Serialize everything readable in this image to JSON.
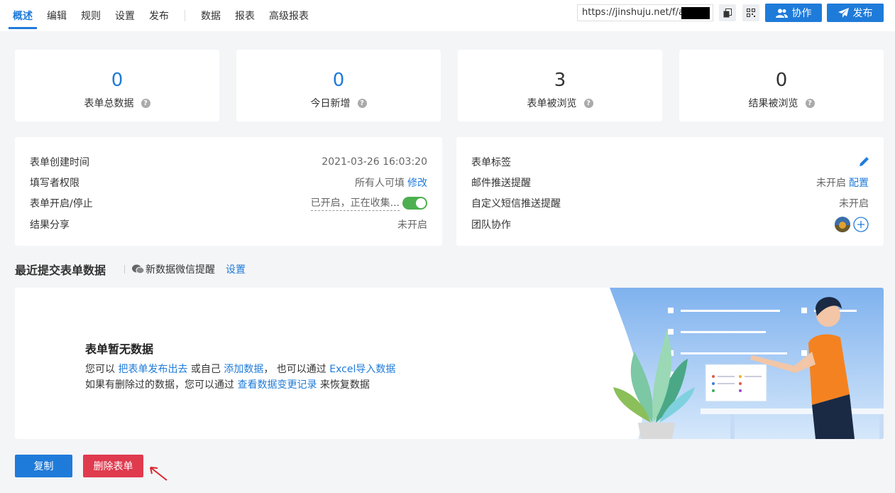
{
  "nav": {
    "tabs": [
      "概述",
      "编辑",
      "规则",
      "设置",
      "发布"
    ],
    "tabs2": [
      "数据",
      "报表",
      "高级报表"
    ],
    "url": "https://jinshuju.net/f/a",
    "collab_label": "协作",
    "publish_label": "发布"
  },
  "stats": [
    {
      "value": "0",
      "label": "表单总数据"
    },
    {
      "value": "0",
      "label": "今日新增"
    },
    {
      "value": "3",
      "label": "表单被浏览"
    },
    {
      "value": "0",
      "label": "结果被浏览"
    }
  ],
  "left_panel": {
    "created_label": "表单创建时间",
    "created_value": "2021-03-26 16:03:20",
    "perm_label": "填写者权限",
    "perm_value": "所有人可填",
    "perm_link": "修改",
    "switch_label": "表单开启/停止",
    "switch_value": "已开启，正在收集...",
    "share_label": "结果分享",
    "share_value": "未开启"
  },
  "right_panel": {
    "tag_label": "表单标签",
    "email_label": "邮件推送提醒",
    "email_value": "未开启",
    "email_link": "配置",
    "sms_label": "自定义短信推送提醒",
    "sms_value": "未开启",
    "team_label": "团队协作"
  },
  "recent": {
    "title": "最近提交表单数据",
    "wechat_label": "新数据微信提醒",
    "settings_link": "设置"
  },
  "empty": {
    "title": "表单暂无数据",
    "line1_a": "您可以 ",
    "line1_link1": "把表单发布出去",
    "line1_b": " 或自己 ",
    "line1_link2": "添加数据",
    "line1_c": "， 也可以通过 ",
    "line1_link3": "Excel导入数据",
    "line2_a": "如果有删除过的数据，您可以通过 ",
    "line2_link": "查看数据变更记录",
    "line2_b": " 来恢复数据"
  },
  "actions": {
    "copy_label": "复制",
    "delete_label": "删除表单"
  },
  "colors": {
    "primary": "#1f7bd9",
    "danger": "#e03a4f",
    "toggle_on": "#4caf50"
  }
}
